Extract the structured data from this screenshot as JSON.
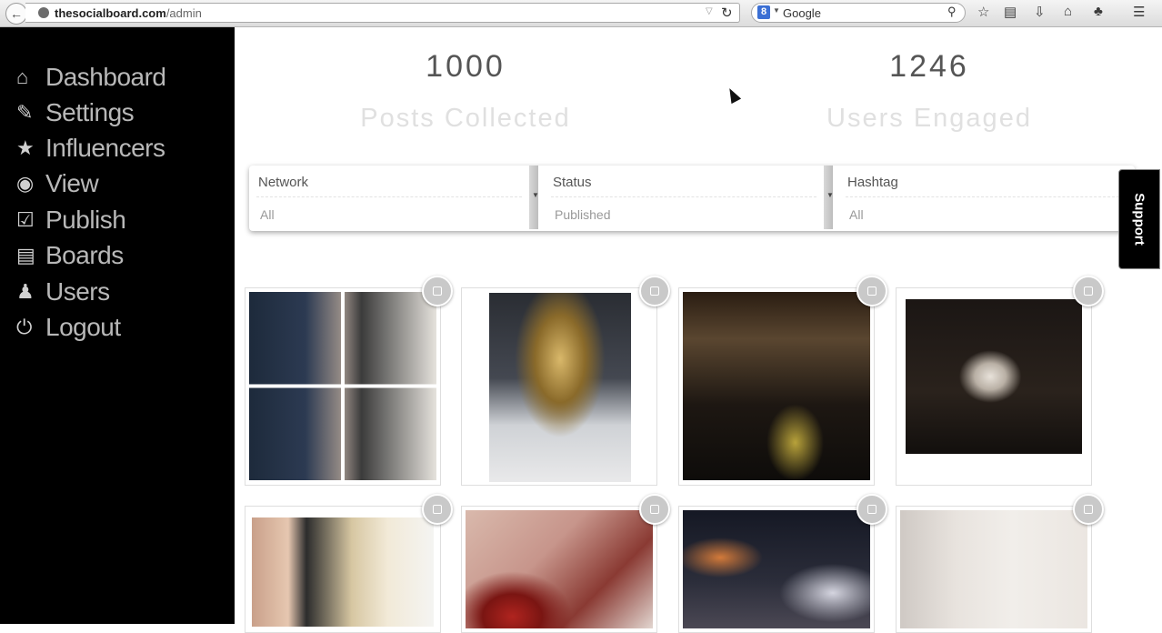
{
  "browser": {
    "url_host": "thesocialboard.com",
    "url_path": "/admin",
    "search_engine": "Google"
  },
  "sidebar": {
    "items": [
      {
        "label": "Dashboard",
        "icon": "home-icon"
      },
      {
        "label": "Settings",
        "icon": "edit-icon"
      },
      {
        "label": "Influencers",
        "icon": "star-icon"
      },
      {
        "label": "View",
        "icon": "eye-icon"
      },
      {
        "label": "Publish",
        "icon": "check-square-icon"
      },
      {
        "label": "Boards",
        "icon": "list-icon"
      },
      {
        "label": "Users",
        "icon": "user-icon"
      },
      {
        "label": "Logout",
        "icon": "power-icon"
      }
    ]
  },
  "stats": [
    {
      "value": "1000",
      "label": "Posts Collected"
    },
    {
      "value": "1246",
      "label": "Users Engaged"
    }
  ],
  "filters": [
    {
      "label": "Network",
      "value": "All"
    },
    {
      "label": "Status",
      "value": "Published"
    },
    {
      "label": "Hashtag",
      "value": "All"
    }
  ],
  "support_label": "Support",
  "colors": {
    "sidebar_bg": "#000000",
    "sidebar_text": "#b8b8b8",
    "stat_label": "#e0e0e0",
    "badge": "#c9c9c9"
  }
}
